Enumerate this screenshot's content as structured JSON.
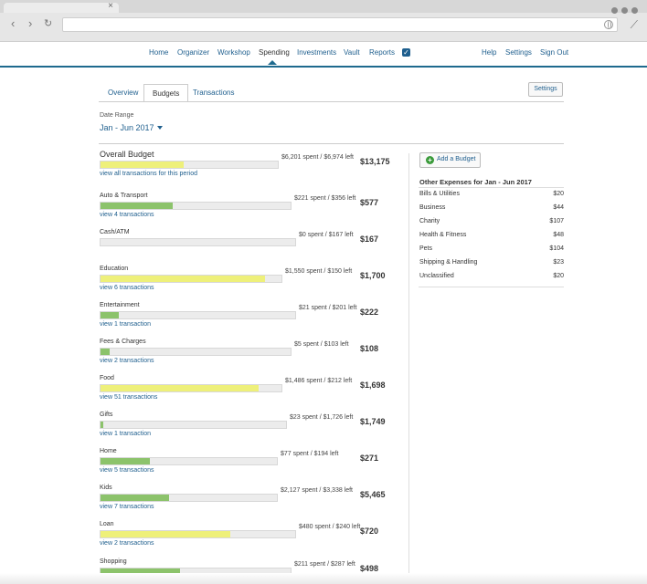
{
  "browser": {
    "tab_close": "×",
    "back_glyph": "‹",
    "forward_glyph": "›",
    "reload_glyph": "↻",
    "ext_glyph": "⟋"
  },
  "nav": {
    "left": [
      "Home",
      "Organizer",
      "Workshop",
      "Spending",
      "Investments",
      "Vault",
      "Reports"
    ],
    "active": "Spending",
    "right": [
      "Help",
      "Settings",
      "Sign Out"
    ]
  },
  "subtabs": {
    "items": [
      "Overview",
      "Budgets",
      "Transactions"
    ],
    "active": "Budgets"
  },
  "settings_button": "Settings",
  "date_range": {
    "label": "Date Range",
    "value": "Jan - Jun 2017"
  },
  "colors": {
    "yellow_bar": "#eef07a",
    "green_bar": "#8cc36b",
    "link": "#1f5f8e",
    "nav_border": "#1e6a8e"
  },
  "budgets": [
    {
      "name": "Overall Budget",
      "spent_left": "$6,201 spent / $6,974 left",
      "total": "$13,175",
      "link": "view all transactions for this period",
      "fill": 0.47,
      "color": "yellow",
      "overall": true
    },
    {
      "name": "Auto & Transport",
      "spent_left": "$221 spent / $356 left",
      "total": "$577",
      "link": "view 4 transactions",
      "fill": 0.38,
      "color": "green"
    },
    {
      "name": "Cash/ATM",
      "spent_left": "$0 spent / $167 left",
      "total": "$167",
      "link": "",
      "fill": 0.0,
      "color": "green"
    },
    {
      "name": "Education",
      "spent_left": "$1,550 spent / $150 left",
      "total": "$1,700",
      "link": "view 6 transactions",
      "fill": 0.91,
      "color": "yellow"
    },
    {
      "name": "Entertainment",
      "spent_left": "$21 spent / $201 left",
      "total": "$222",
      "link": "view 1 transaction",
      "fill": 0.095,
      "color": "green"
    },
    {
      "name": "Fees & Charges",
      "spent_left": "$5 spent / $103 left",
      "total": "$108",
      "link": "view 2 transactions",
      "fill": 0.046,
      "color": "green"
    },
    {
      "name": "Food",
      "spent_left": "$1,486 spent / $212 left",
      "total": "$1,698",
      "link": "view 51 transactions",
      "fill": 0.875,
      "color": "yellow"
    },
    {
      "name": "Gifts",
      "spent_left": "$23 spent / $1,726 left",
      "total": "$1,749",
      "link": "view 1 transaction",
      "fill": 0.013,
      "color": "green"
    },
    {
      "name": "Home",
      "spent_left": "$77 spent / $194 left",
      "total": "$271",
      "link": "view 5 transactions",
      "fill": 0.28,
      "color": "green"
    },
    {
      "name": "Kids",
      "spent_left": "$2,127 spent / $3,338 left",
      "total": "$5,465",
      "link": "view 7 transactions",
      "fill": 0.39,
      "color": "green"
    },
    {
      "name": "Loan",
      "spent_left": "$480 spent / $240 left",
      "total": "$720",
      "link": "view 2 transactions",
      "fill": 0.667,
      "color": "yellow"
    },
    {
      "name": "Shopping",
      "spent_left": "$211 spent / $287 left",
      "total": "$498",
      "link": "",
      "fill": 0.42,
      "color": "green"
    }
  ],
  "add_budget_label": "Add a Budget",
  "other_expenses": {
    "title": "Other Expenses for Jan - Jun 2017",
    "items": [
      {
        "name": "Bills & Utilities",
        "amount": "$20"
      },
      {
        "name": "Business",
        "amount": "$44"
      },
      {
        "name": "Charity",
        "amount": "$107"
      },
      {
        "name": "Health & Fitness",
        "amount": "$48"
      },
      {
        "name": "Pets",
        "amount": "$104"
      },
      {
        "name": "Shipping & Handling",
        "amount": "$23"
      },
      {
        "name": "Unclassified",
        "amount": "$20"
      }
    ]
  }
}
